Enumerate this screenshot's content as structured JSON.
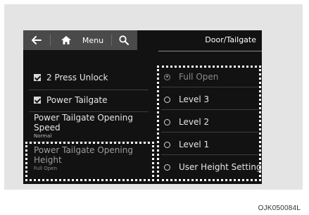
{
  "toolbar": {
    "back_icon": "back-arrow-icon",
    "home_icon": "home-icon",
    "menu_label": "Menu",
    "search_icon": "search-icon"
  },
  "header": {
    "title": "Door/Tailgate"
  },
  "left_items": [
    {
      "label": "2 Press Unlock",
      "checked": true
    },
    {
      "label": "Power Tailgate",
      "checked": true
    },
    {
      "label": "Power Tailgate Opening Speed",
      "value": "Normal"
    },
    {
      "label": "Power Tailgate Opening Height",
      "value": "Full Open"
    }
  ],
  "options": [
    {
      "label": "Full Open",
      "selected": true
    },
    {
      "label": "Level 3",
      "selected": false
    },
    {
      "label": "Level 2",
      "selected": false
    },
    {
      "label": "Level 1",
      "selected": false
    },
    {
      "label": "User Height Setting",
      "selected": false
    }
  ],
  "caption": "OJK050084L",
  "colors": {
    "screen_bg": "#121212",
    "toolbar_bg": "#4a4a4a",
    "frame_bg": "#e4e4e4",
    "highlight": "#ffffff"
  }
}
